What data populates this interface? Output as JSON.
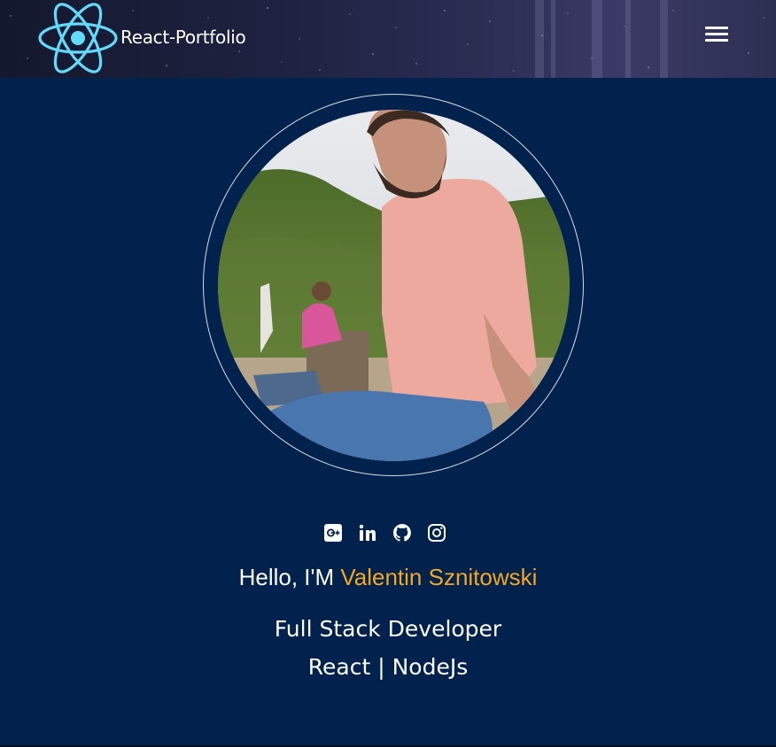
{
  "navbar": {
    "brand": "React-Portfolio",
    "logo_icon": "react-atom-icon",
    "menu_icon": "hamburger-menu-icon",
    "accent": "#61dafb"
  },
  "profile": {
    "photo_alt": "profile-photo"
  },
  "social": [
    {
      "name": "google-plus-icon"
    },
    {
      "name": "linkedin-icon"
    },
    {
      "name": "github-icon"
    },
    {
      "name": "instagram-icon"
    }
  ],
  "intro": {
    "greeting": "Hello, I'M ",
    "name": "Valentin Sznitowski",
    "name_color": "#f5a623",
    "role_line1": "Full Stack Developer",
    "role_line2": "React | NodeJs"
  },
  "colors": {
    "background": "#00224d",
    "text": "#ffffff"
  }
}
